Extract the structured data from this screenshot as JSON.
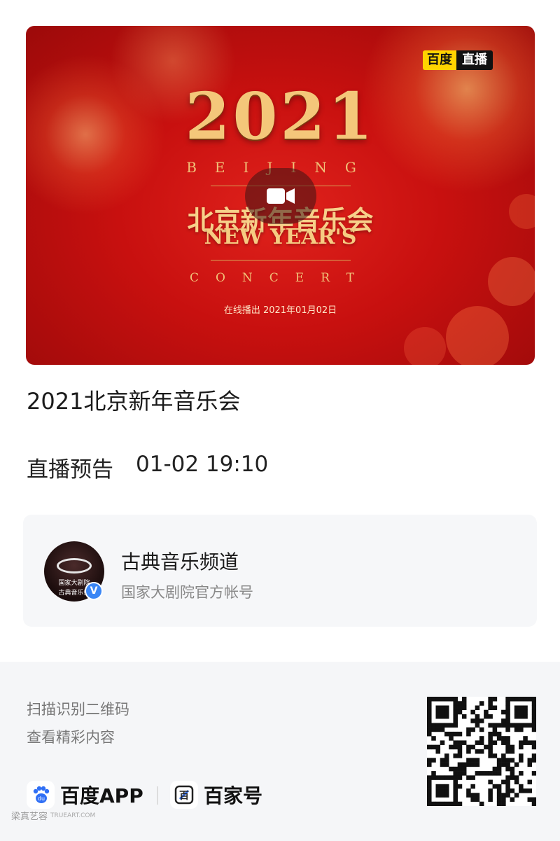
{
  "poster": {
    "badge_left": "百度",
    "badge_right": "直播",
    "year": "2021",
    "beijing": "BEIJING",
    "zh_title": "北京新年音乐会",
    "en_title": "NEW YEAR'S",
    "concert": "CONCERT",
    "airdate": "在线播出 2021年01月02日",
    "play_icon": "video-camera-icon"
  },
  "title": "2021北京新年音乐会",
  "preview": {
    "label": "直播预告",
    "time": "01-02 19:10"
  },
  "account": {
    "name": "古典音乐频道",
    "subtitle": "国家大剧院官方帐号",
    "avatar_line1": "国家大剧院",
    "avatar_line2": "古典音乐频",
    "verified": "V"
  },
  "footer": {
    "scan_line1": "扫描识别二维码",
    "scan_line2": "查看精彩内容",
    "brand1": "百度APP",
    "brand1_icon": "du",
    "brand2": "百家号",
    "brand2_icon": "百",
    "watermark": "梁真艺容",
    "watermark_sub": "TRUEART.COM"
  },
  "colors": {
    "poster_red": "#c8100f",
    "gold": "#f4c77a",
    "badge_yellow": "#ffd400",
    "verified_blue": "#3a86f5",
    "baidu_blue": "#2f6ff5"
  }
}
